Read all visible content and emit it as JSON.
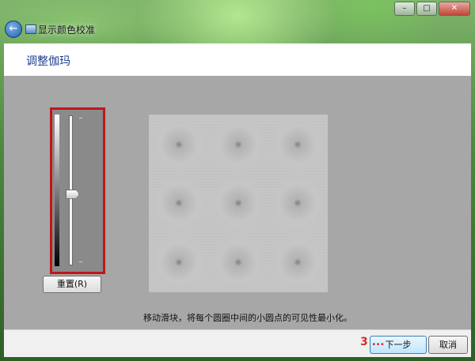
{
  "window": {
    "title": "显示颜色校准",
    "minimize": "–",
    "maximize": "□",
    "close": "✕",
    "back_icon": "arrow-left-icon"
  },
  "header": {
    "title": "调整伽玛"
  },
  "slider": {
    "level": 0.52,
    "accent": "#c0161b"
  },
  "buttons": {
    "reset": "重置(R)",
    "next": "下一步",
    "cancel": "取消"
  },
  "instruction": "移动滑块，将每个圆圈中间的小圆点的可见性最小化。",
  "watermark": "3 ..."
}
